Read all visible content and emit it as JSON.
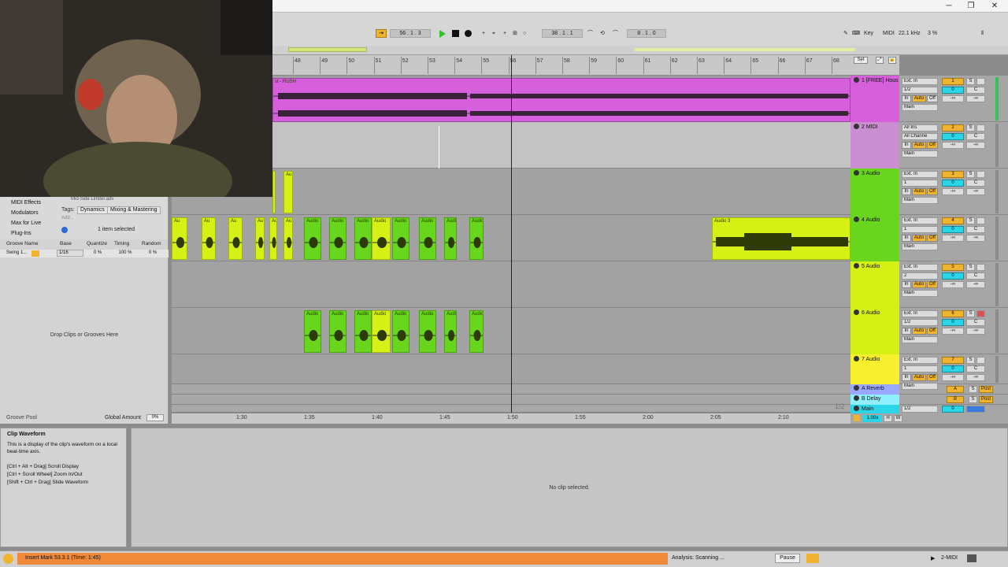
{
  "colors": {
    "magenta": "#d65fdc",
    "magenta_light": "#c98fd0",
    "lime": "#d4f014",
    "green": "#67d61c",
    "yellow": "#f6f02f",
    "orange_status": "#f08a3a",
    "cyan": "#29d5e6",
    "blue_return": "#9aa8ff",
    "cyan_return": "#8ef0ff"
  },
  "window_controls": {
    "minimize": "─",
    "maximize": "❐",
    "close": "✕"
  },
  "transport": {
    "song_position": "56 .   1 .   3",
    "loop_start": "38 .   1 .   1",
    "loop_length": "8 .   1 .   0",
    "key_label": "Key",
    "midi_label": "MIDI",
    "sample_rate": "22.1 kHz",
    "cpu": "3 %"
  },
  "ruler": {
    "bars": [
      "48",
      "49",
      "50",
      "51",
      "52",
      "53",
      "54",
      "55",
      "56",
      "57",
      "58",
      "59",
      "60",
      "61",
      "62",
      "63",
      "64",
      "65",
      "66",
      "67",
      "68"
    ],
    "set_label": "Set"
  },
  "time_ruler": [
    "1:30",
    "1:35",
    "1:40",
    "1:45",
    "1:50",
    "1:55",
    "2:00",
    "2:05",
    "2:10"
  ],
  "page_indicator": "1/2",
  "tracks": [
    {
      "name": "1 [FREE] Hous",
      "input": "Ext. In",
      "channel": "1/2",
      "number": "1",
      "output": "Main",
      "vol": "0",
      "pan": "C",
      "send": "-∞"
    },
    {
      "name": "2 MIDI",
      "input": "All Ins",
      "channel": "All Channe",
      "number": "2",
      "output": "Main",
      "vol": "0",
      "pan": "C",
      "send": "-∞"
    },
    {
      "name": "3 Audio",
      "input": "Ext. In",
      "channel": "1",
      "number": "3",
      "output": "Main",
      "vol": "0",
      "pan": "C",
      "send": "-∞"
    },
    {
      "name": "4 Audio",
      "input": "Ext. In",
      "channel": "1",
      "number": "4",
      "output": "Main",
      "vol": "0",
      "pan": "C",
      "send": "-∞"
    },
    {
      "name": "5 Audio",
      "input": "Ext. In",
      "channel": "2",
      "number": "5",
      "output": "Main",
      "vol": "0",
      "pan": "C",
      "send": "-∞"
    },
    {
      "name": "6 Audio",
      "input": "Ext. In",
      "channel": "1/2",
      "number": "6",
      "output": "Main",
      "vol": "0",
      "pan": "C",
      "send": "-∞"
    },
    {
      "name": "7 Audio",
      "input": "Ext. In",
      "channel": "1",
      "number": "7",
      "output": "Main",
      "vol": "0",
      "pan": "C",
      "send": "-∞"
    }
  ],
  "returns": [
    {
      "name": "A Reverb",
      "letter": "A",
      "post": "Post"
    },
    {
      "name": "B Delay",
      "letter": "B",
      "post": "Post"
    }
  ],
  "main": {
    "name": "Main",
    "channel": "1/2",
    "vol": "0",
    "zoom": "1.00x"
  },
  "mixer_labels": {
    "in": "In",
    "auto": "Auto",
    "off": "Off",
    "solo": "S",
    "pan_c": "C",
    "h": "H",
    "w": "W"
  },
  "clips": {
    "track1_title": "st - RUSH",
    "audio_label": "Audio",
    "audio_short": "Au",
    "audio3_label": "Audio 3"
  },
  "browser": {
    "items": [
      "MIDI Effects",
      "Modulators",
      "Max for Live",
      "Plug-Ins"
    ],
    "file_partial": "Mid-Side Limiter.adv",
    "tags_label": "Tags:",
    "tags": [
      "Dynamics",
      "Mixing & Mastering"
    ],
    "add_label": "Add...",
    "selected_text": "1 item selected"
  },
  "groove_pool": {
    "headers": [
      "Groove Name",
      "Base",
      "Quantize",
      "Timing",
      "Random"
    ],
    "row": {
      "name": "Swing 1...",
      "base": "1/16",
      "quantize": "0 %",
      "timing": "100 %",
      "random": "0 %"
    },
    "drop_text": "Drop Clips or Grooves Here",
    "footer_left": "Groove Pool",
    "global_amount_label": "Global Amount",
    "global_amount_value": "0%"
  },
  "info_view": {
    "title": "Clip Waveform",
    "body": "This is a display of the clip's waveform on a local beat-time axis.",
    "shortcuts": [
      "[Ctrl + Alt + Drag] Scroll Display",
      "[Ctrl + Scroll Wheel] Zoom In/Out",
      "[Shift + Ctrl + Drag] Slide Waveform"
    ]
  },
  "detail_text": "No clip selected.",
  "status": {
    "message": "Insert Mark 53.3.1 (Time: 1:45)",
    "analysis": "Analysis: Scanning ...",
    "pause_label": "Pause",
    "midi_track": "2-MIDI"
  }
}
